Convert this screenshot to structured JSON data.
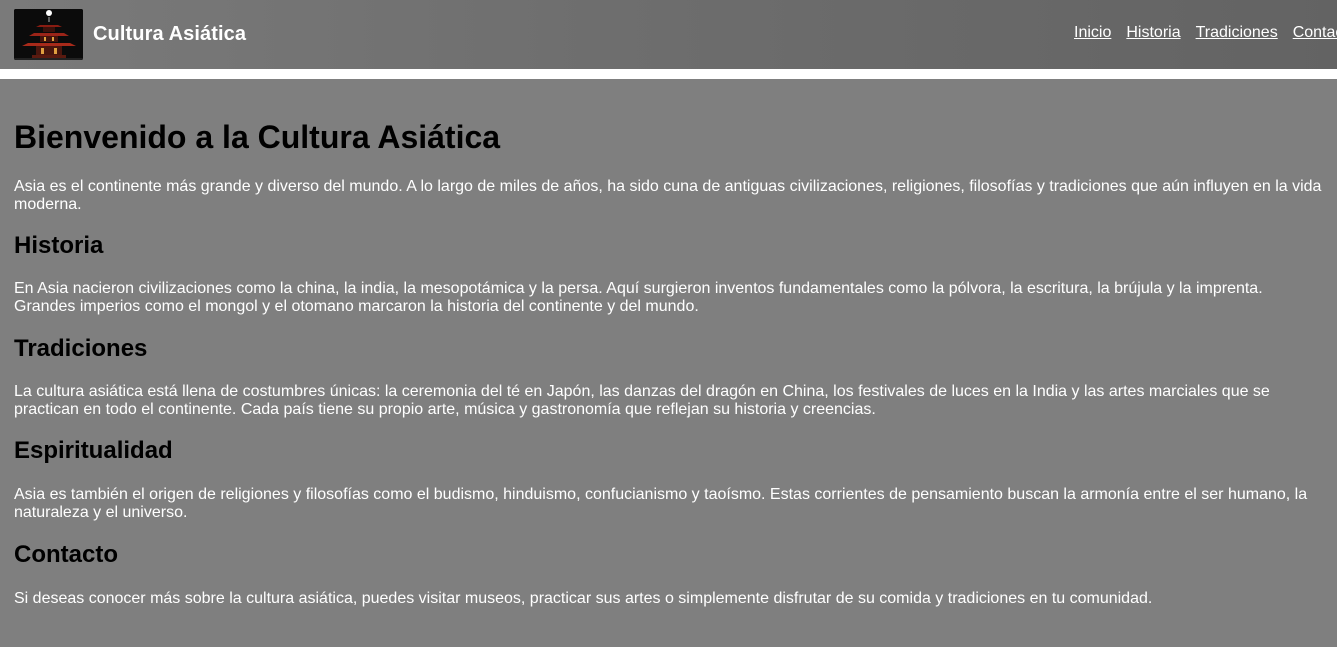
{
  "header": {
    "logo_icon": "pagoda-logo-icon",
    "title": "Cultura Asiática",
    "nav": [
      {
        "label": "Inicio"
      },
      {
        "label": "Historia"
      },
      {
        "label": "Tradiciones"
      },
      {
        "label": "Contacto"
      }
    ]
  },
  "main": {
    "title": "Bienvenido a la Cultura Asiática",
    "intro": "Asia es el continente más grande y diverso del mundo. A lo largo de miles de años, ha sido cuna de antiguas civilizaciones, religiones, filosofías y tradiciones que aún influyen en la vida moderna.",
    "sections": [
      {
        "heading": "Historia",
        "text": "En Asia nacieron civilizaciones como la china, la india, la mesopotámica y la persa. Aquí surgieron inventos fundamentales como la pólvora, la escritura, la brújula y la imprenta. Grandes imperios como el mongol y el otomano marcaron la historia del continente y del mundo."
      },
      {
        "heading": "Tradiciones",
        "text": "La cultura asiática está llena de costumbres únicas: la ceremonia del té en Japón, las danzas del dragón en China, los festivales de luces en la India y las artes marciales que se practican en todo el continente. Cada país tiene su propio arte, música y gastronomía que reflejan su historia y creencias."
      },
      {
        "heading": "Espiritualidad",
        "text": "Asia es también el origen de religiones y filosofías como el budismo, hinduismo, confucianismo y taoísmo. Estas corrientes de pensamiento buscan la armonía entre el ser humano, la naturaleza y el universo."
      },
      {
        "heading": "Contacto",
        "text": "Si deseas conocer más sobre la cultura asiática, puedes visitar museos, practicar sus artes o simplemente disfrutar de su comida y tradiciones en tu comunidad."
      }
    ]
  },
  "colors": {
    "page_background": "#7f7f7f",
    "header_background": "#6e6e6e",
    "heading_text": "#000000",
    "body_text": "#ffffff"
  }
}
